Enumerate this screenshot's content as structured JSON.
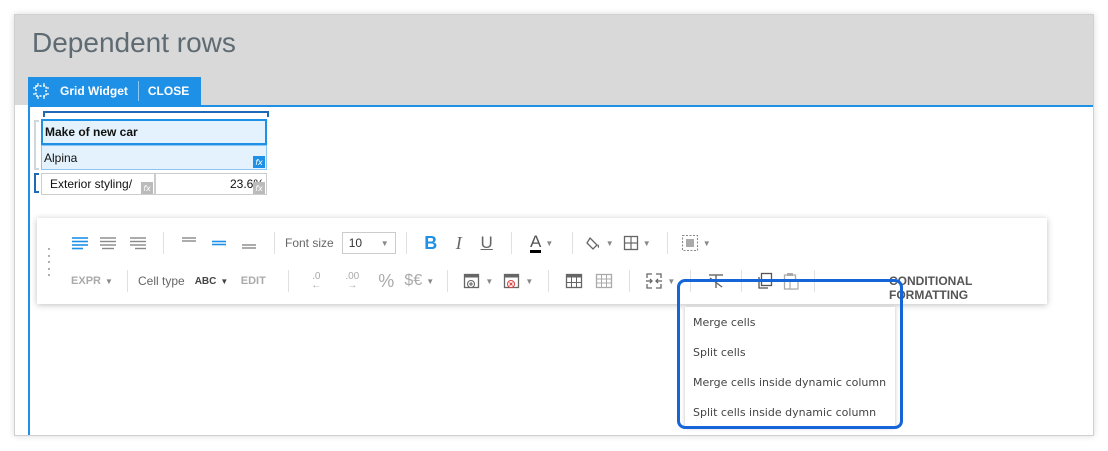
{
  "page": {
    "title": "Dependent rows"
  },
  "widget_tab": {
    "label": "Grid Widget",
    "close_label": "CLOSE"
  },
  "grid": {
    "header_cell": "Make of new car",
    "value_cell": "Alpina",
    "row_label": "Exterior styling/",
    "row_value": "23.6%",
    "fx_symbol": "fx"
  },
  "toolbar": {
    "font_size_label": "Font size",
    "font_size_value": "10",
    "bold": "B",
    "italic": "I",
    "underline": "U",
    "font_color": "A",
    "expr_label": "EXPR",
    "cell_type_label": "Cell type",
    "cell_type_value": "ABC",
    "edit_label": "EDIT",
    "dec_decrease": ".0",
    "dec_increase": ".00",
    "percent": "%",
    "currency": "$€",
    "conditional_formatting": "CONDITIONAL FORMATTING"
  },
  "merge_menu": {
    "items": [
      {
        "label": "Merge cells"
      },
      {
        "label": "Split cells"
      },
      {
        "label": "Merge cells inside dynamic column"
      },
      {
        "label": "Split cells inside dynamic column"
      }
    ]
  },
  "colors": {
    "accent": "#1e90e6",
    "highlight": "#1565d8"
  }
}
